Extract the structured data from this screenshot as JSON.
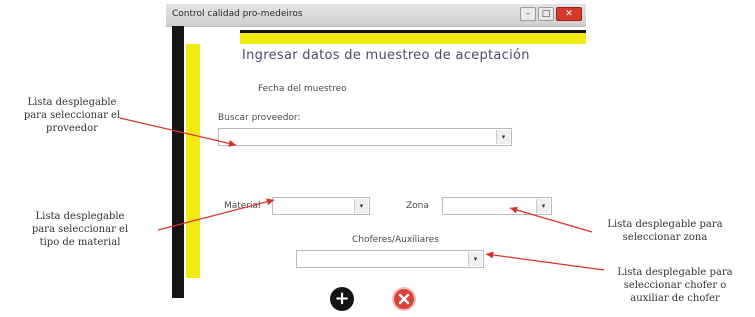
{
  "window": {
    "title": "Control calidad pro-medeiros",
    "controls": {
      "minimize": "–",
      "maximize": "□",
      "close": "✕"
    }
  },
  "form": {
    "heading": "Ingresar datos de muestreo de aceptación",
    "fecha_label": "Fecha del muestreo",
    "proveedor_label": "Buscar proveedor:",
    "proveedor_value": "",
    "material_label": "Material",
    "material_value": "",
    "zona_label": "Zona",
    "zona_value": "",
    "chofer_label": "Choferes/Auxiliares",
    "chofer_value": "",
    "dropdown_arrow": "▾",
    "add_icon": "plus-circle-icon",
    "cancel_icon": "cancel-circle-icon"
  },
  "annotations": {
    "proveedor_note": [
      "Lista desplegable",
      "para seleccionar el",
      "proveedor"
    ],
    "material_note": [
      "Lista desplegable",
      "para seleccionar el",
      "tipo de material"
    ],
    "zona_note": [
      "Lista desplegable para",
      "seleccionar zona"
    ],
    "chofer_note": [
      "Lista desplegable para",
      "seleccionar chofer o",
      "auxiliar de chofer"
    ],
    "arrow_color": "#d9322b"
  }
}
